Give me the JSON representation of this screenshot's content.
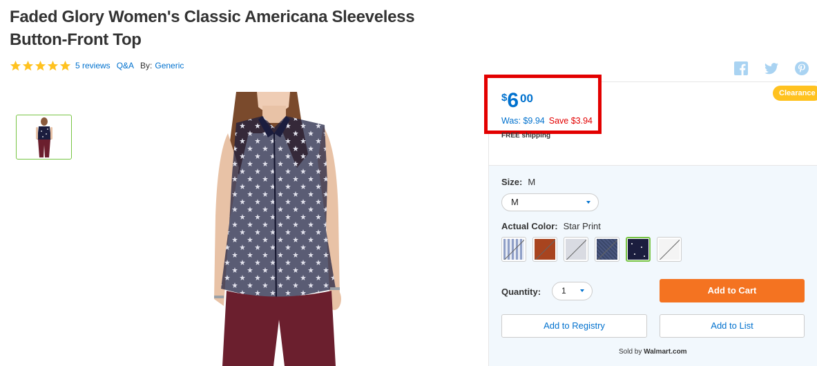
{
  "product": {
    "title": "Faded Glory Women's Classic Americana Sleeveless Button-Front Top",
    "rating_stars": 5,
    "reviews_label": "5 reviews",
    "qa_label": "Q&A",
    "by_label": "By:",
    "brand": "Generic"
  },
  "social": [
    "facebook-icon",
    "twitter-icon",
    "pinterest-icon"
  ],
  "badge": {
    "clearance": "Clearance"
  },
  "price": {
    "currency": "$",
    "dollars": "6",
    "cents": "00",
    "was": "Was: $9.94",
    "save": "Save $3.94",
    "shipping": "FREE shipping"
  },
  "options": {
    "size_label": "Size:",
    "size_value": "M",
    "size_selected": "M",
    "color_label": "Actual Color:",
    "color_value": "Star Print",
    "swatches": [
      {
        "name": "stripe",
        "color": "#c9d3e6",
        "selected": false
      },
      {
        "name": "rust",
        "color": "#a8441f",
        "selected": false
      },
      {
        "name": "light-gray",
        "color": "#d9dbe2",
        "selected": false
      },
      {
        "name": "denim",
        "color": "#3a4769",
        "selected": false
      },
      {
        "name": "star-print",
        "color": "#1b1d3e",
        "selected": true
      },
      {
        "name": "white",
        "color": "#f4f4f4",
        "selected": false
      }
    ]
  },
  "purchase": {
    "quantity_label": "Quantity:",
    "quantity_value": "1",
    "add_to_cart": "Add to Cart",
    "add_to_registry": "Add to Registry",
    "add_to_list": "Add to List",
    "sold_by_prefix": "Sold by",
    "seller": "Walmart.com"
  },
  "colors": {
    "accent_blue": "#0071ce",
    "cart_orange": "#f47321",
    "highlight_red": "#e30000",
    "clearance_yellow": "#ffc220",
    "star_yellow": "#ffc220",
    "selected_green": "#76c442"
  }
}
